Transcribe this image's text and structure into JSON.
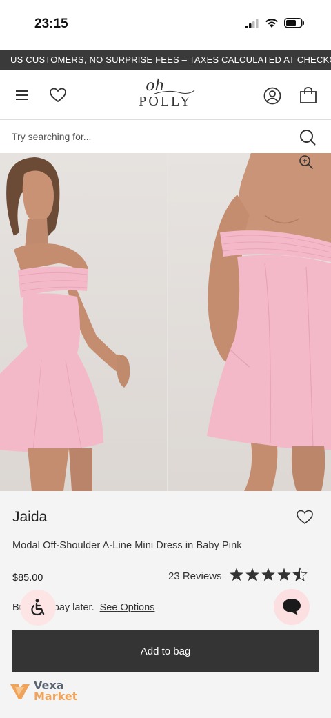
{
  "status_bar": {
    "time": "23:15",
    "icons": [
      "signal-icon",
      "wifi-icon",
      "battery-icon"
    ]
  },
  "promo_banner": {
    "text": "US CUSTOMERS, NO SURPRISE FEES – TAXES CALCULATED AT CHECKOUT, DU"
  },
  "header": {
    "logo_script": "oh",
    "logo_word": "POLLY",
    "icons": [
      "menu-icon",
      "heart-icon",
      "account-icon",
      "bag-icon"
    ]
  },
  "search": {
    "placeholder": "Try searching for..."
  },
  "gallery": {
    "images": [
      "model-side-view",
      "model-front-closeup"
    ],
    "zoom_icon": "zoom-in-icon"
  },
  "product": {
    "name": "Jaida",
    "description": "Modal Off-Shoulder A-Line Mini Dress in Baby Pink",
    "price": "$85.00",
    "reviews_label": "23 Reviews",
    "rating": 4.5,
    "rating_max": 5,
    "bnpl_prefix": "Bu",
    "bnpl_suffix": "pay later.",
    "bnpl_link": "See Options",
    "add_to_bag_label": "Add to bag"
  },
  "watermark": {
    "line1": "Vexa",
    "line2": "Market"
  },
  "colors": {
    "banner_bg": "#3a3a3a",
    "button_bg": "#343434",
    "info_bg": "#f4f4f4",
    "dress_pink": "#f4b9c8",
    "chat_bubble_bg": "#fcdfe0"
  }
}
